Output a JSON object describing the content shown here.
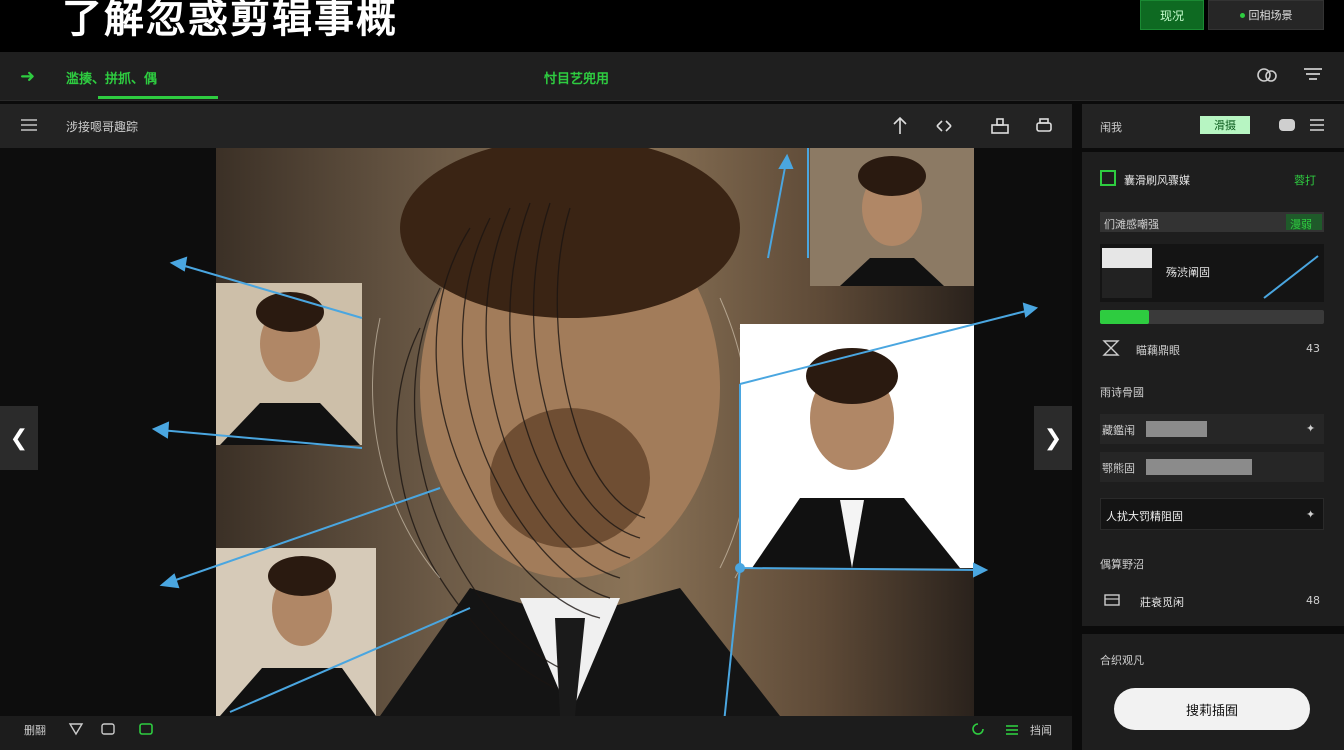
{
  "header": {
    "title": "了解忽惑剪辑事概",
    "primary_button": "现况",
    "secondary_button": "回相场景"
  },
  "menubar": {
    "left_label": "滥揍、拼抓、偶",
    "center_label": "忖目艺兜用"
  },
  "canvas": {
    "toolbar_label": "涉接嗯哥趣踪",
    "bottom_left_label": "删翮",
    "bottom_right_label": "挡闻"
  },
  "right_panel": {
    "header_label": "闱我",
    "header_tab_active": "滑摄",
    "section_title": "囊滑刷风骤媒",
    "section_action": "蓉打",
    "field_label": "们滩感嘲强",
    "field_tag": "漫弱",
    "preview_label": "殇渋阐固",
    "progress_value": 0.22,
    "filter_label": "瞄藕鼎眼",
    "filter_value": "43",
    "group_label": "雨诗骨國",
    "slider1_label": "藏鑑闱",
    "slider1_value": 0.55,
    "slider2_label": "鄂熊固",
    "slider2_value": 0.85,
    "select_value": "人扰大罚精阻固",
    "group2_label": "偶算野沼",
    "item_label": "莊衰觅闲",
    "item_value": "48",
    "footer_label": "合织观凡",
    "cta_button": "搜莉插囿"
  },
  "colors": {
    "accent": "#2ecc40",
    "guide": "#4aa6e0",
    "panel": "#1e1e1e"
  }
}
